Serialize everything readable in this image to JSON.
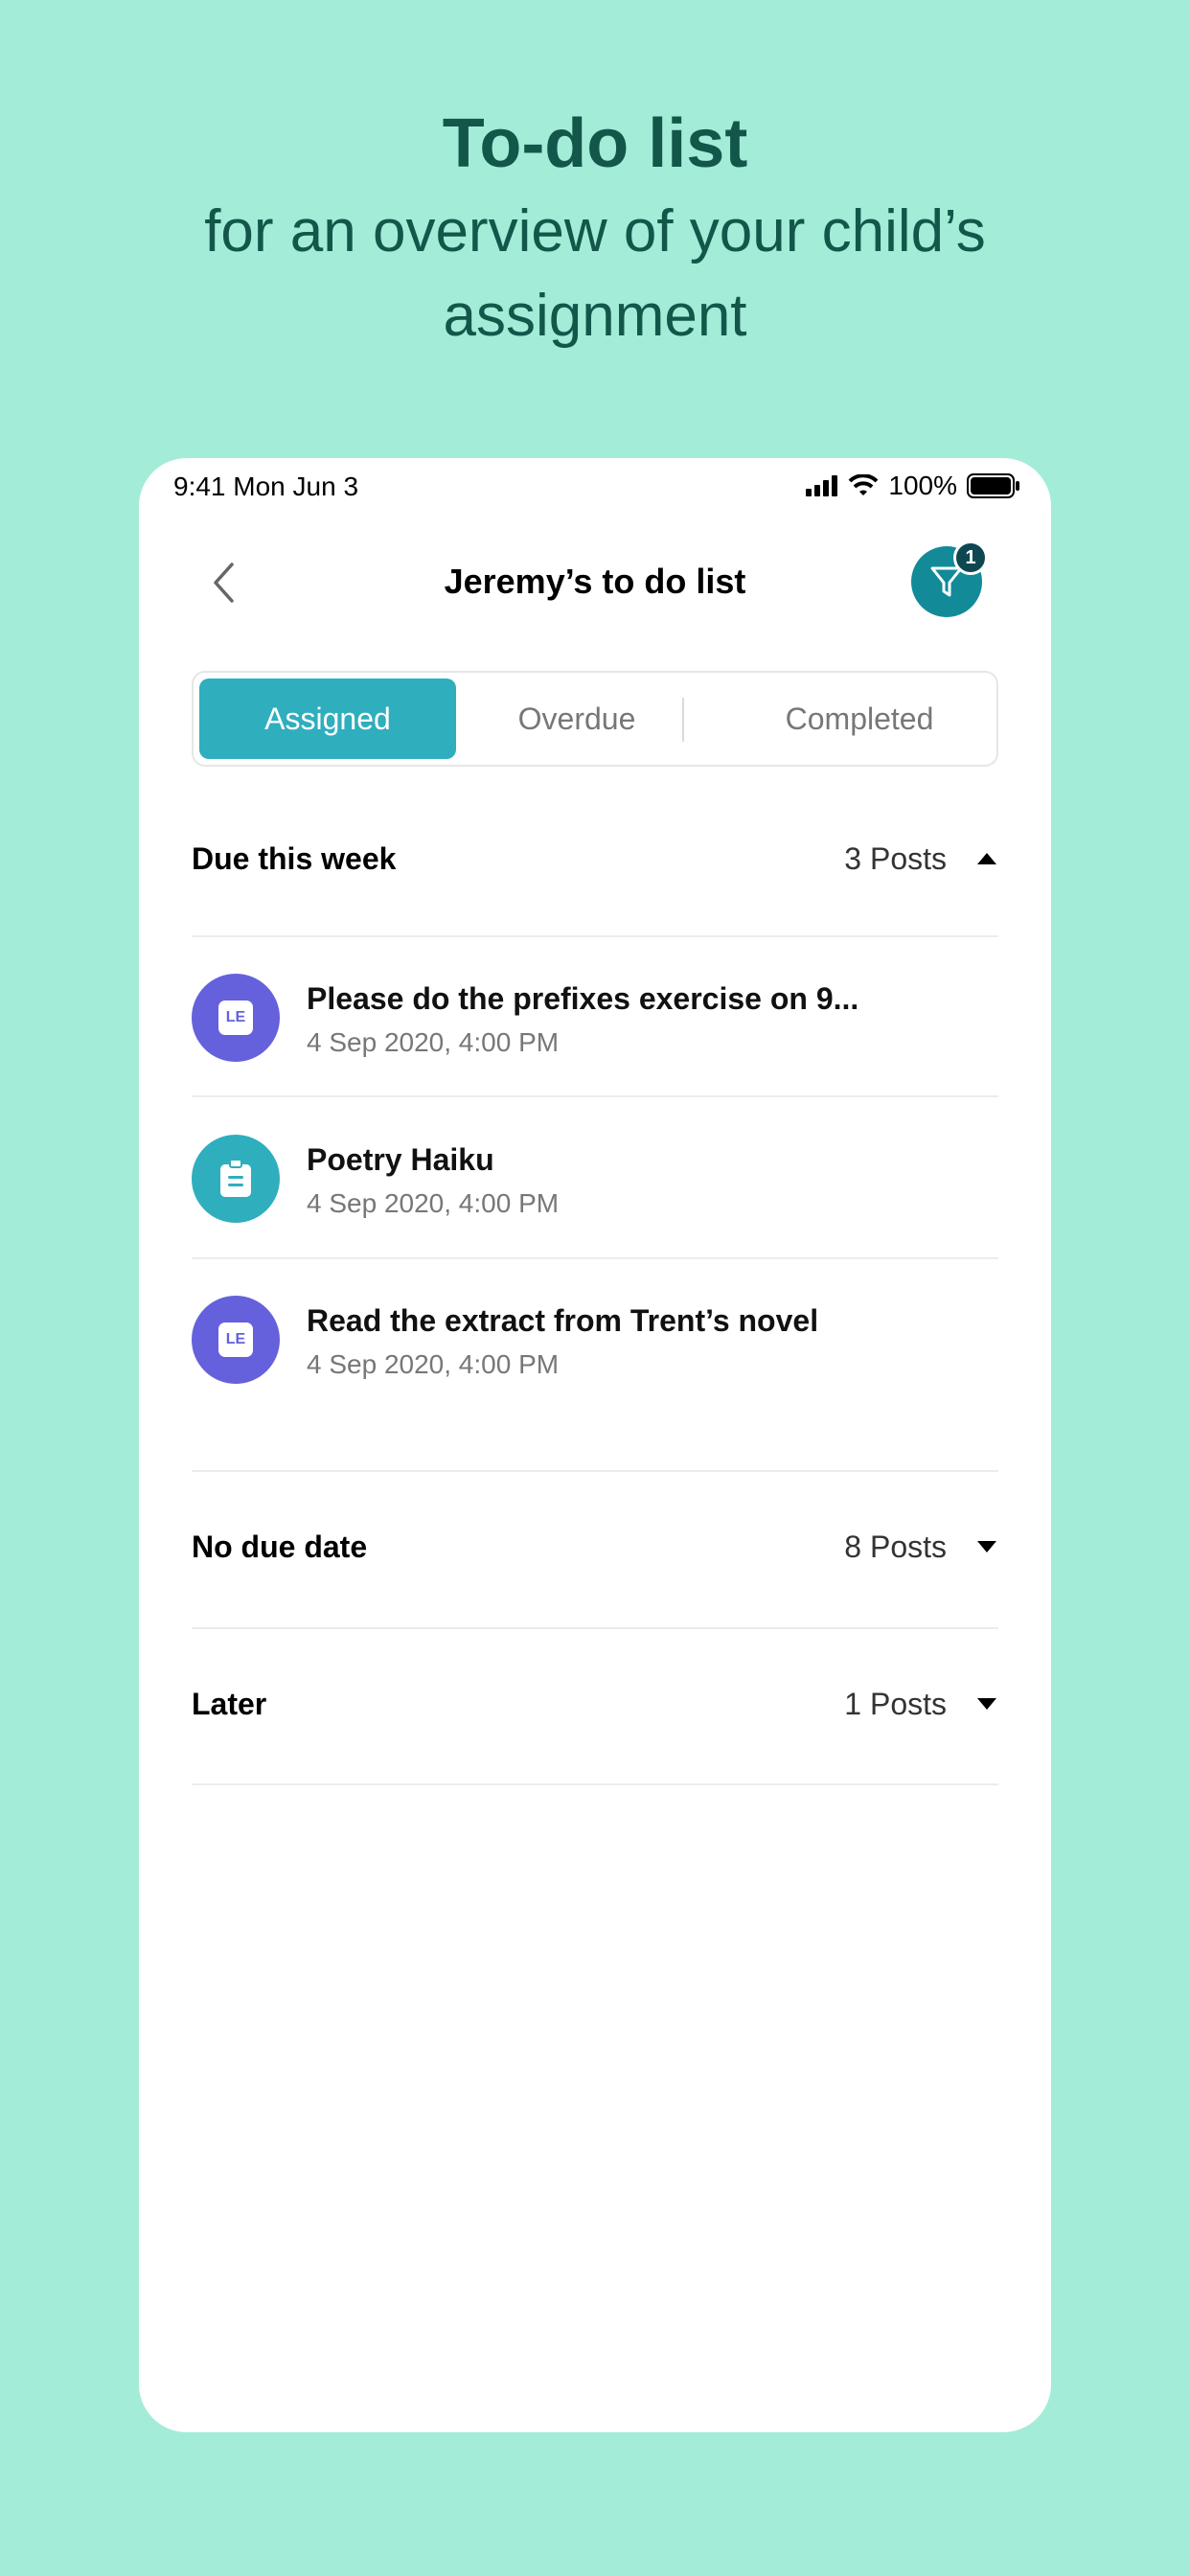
{
  "promo": {
    "title": "To-do list",
    "subtitle": "for an overview of your child’s assignment"
  },
  "status_bar": {
    "time": "9:41  Mon Jun 3",
    "battery": "100%",
    "icons": [
      "signal-icon",
      "wifi-icon",
      "battery-icon"
    ]
  },
  "header": {
    "title": "Jeremy’s to do list",
    "back_icon": "chevron-left-icon",
    "filter_icon": "filter-icon",
    "filter_badge": "1"
  },
  "tabs": [
    {
      "label": "Assigned",
      "active": true
    },
    {
      "label": "Overdue",
      "active": false
    },
    {
      "label": "Completed",
      "active": false
    }
  ],
  "sections": [
    {
      "title": "Due this week",
      "count": "3 Posts",
      "expanded": true,
      "posts": [
        {
          "title": "Please do the prefixes exercise on 9...",
          "date": "4 Sep 2020, 4:00 PM",
          "icon": "le-icon",
          "icon_label": "LE"
        },
        {
          "title": "Poetry Haiku",
          "date": "4 Sep 2020, 4:00 PM",
          "icon": "clipboard-icon"
        },
        {
          "title": "Read the extract from Trent’s novel",
          "date": "4 Sep 2020, 4:00 PM",
          "icon": "le-icon",
          "icon_label": "LE"
        }
      ]
    },
    {
      "title": "No due date",
      "count": "8 Posts",
      "expanded": false
    },
    {
      "title": "Later",
      "count": "1 Posts",
      "expanded": false
    }
  ],
  "colors": {
    "background": "#A3ECD8",
    "promo_text": "#13574A",
    "accent": "#2FAEBE",
    "filter_button": "#128A98",
    "le_avatar": "#6560DB"
  }
}
